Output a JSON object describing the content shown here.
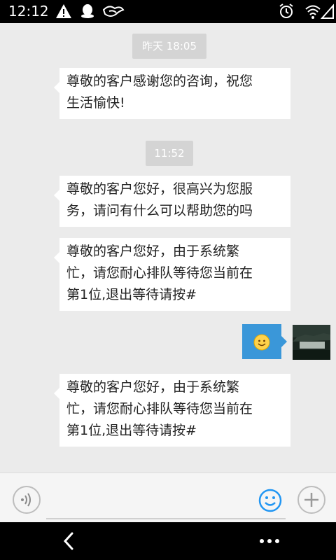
{
  "status_bar": {
    "time": "12:12",
    "icons": [
      "warning-icon",
      "qq-icon",
      "hand-icon",
      "alarm-icon",
      "wifi-icon",
      "signal-icon"
    ]
  },
  "chat": {
    "timestamp_1": "昨天 18:05",
    "message_1": [
      "尊敬的客户感谢您的咨询，祝您",
      "生活愉快!"
    ],
    "timestamp_2": "11:52",
    "message_2": [
      "尊敬的客户您好，很高兴为您服",
      "务，请问有什么可以帮助您的吗"
    ],
    "message_3": [
      "尊敬的客户您好，由于系统繁",
      "忙，请您耐心排队等待您当前在",
      "第1位,退出等待请按#"
    ],
    "my_message_icon": "smile-emoji",
    "message_4": [
      "尊敬的客户您好，由于系统繁",
      "忙，请您耐心排队等待您当前在",
      "第1位,退出等待请按#"
    ]
  },
  "input_bar": {
    "voice_icon": "voice-icon",
    "emoji_icon": "smile-icon",
    "add_icon": "plus-icon"
  },
  "nav_bar": {
    "back_icon": "back-chevron-icon",
    "more_icon": "more-dots-icon"
  },
  "colors": {
    "chat_bg": "#ebebeb",
    "my_bubble": "#3a97d9",
    "accent": "#2196f3"
  }
}
